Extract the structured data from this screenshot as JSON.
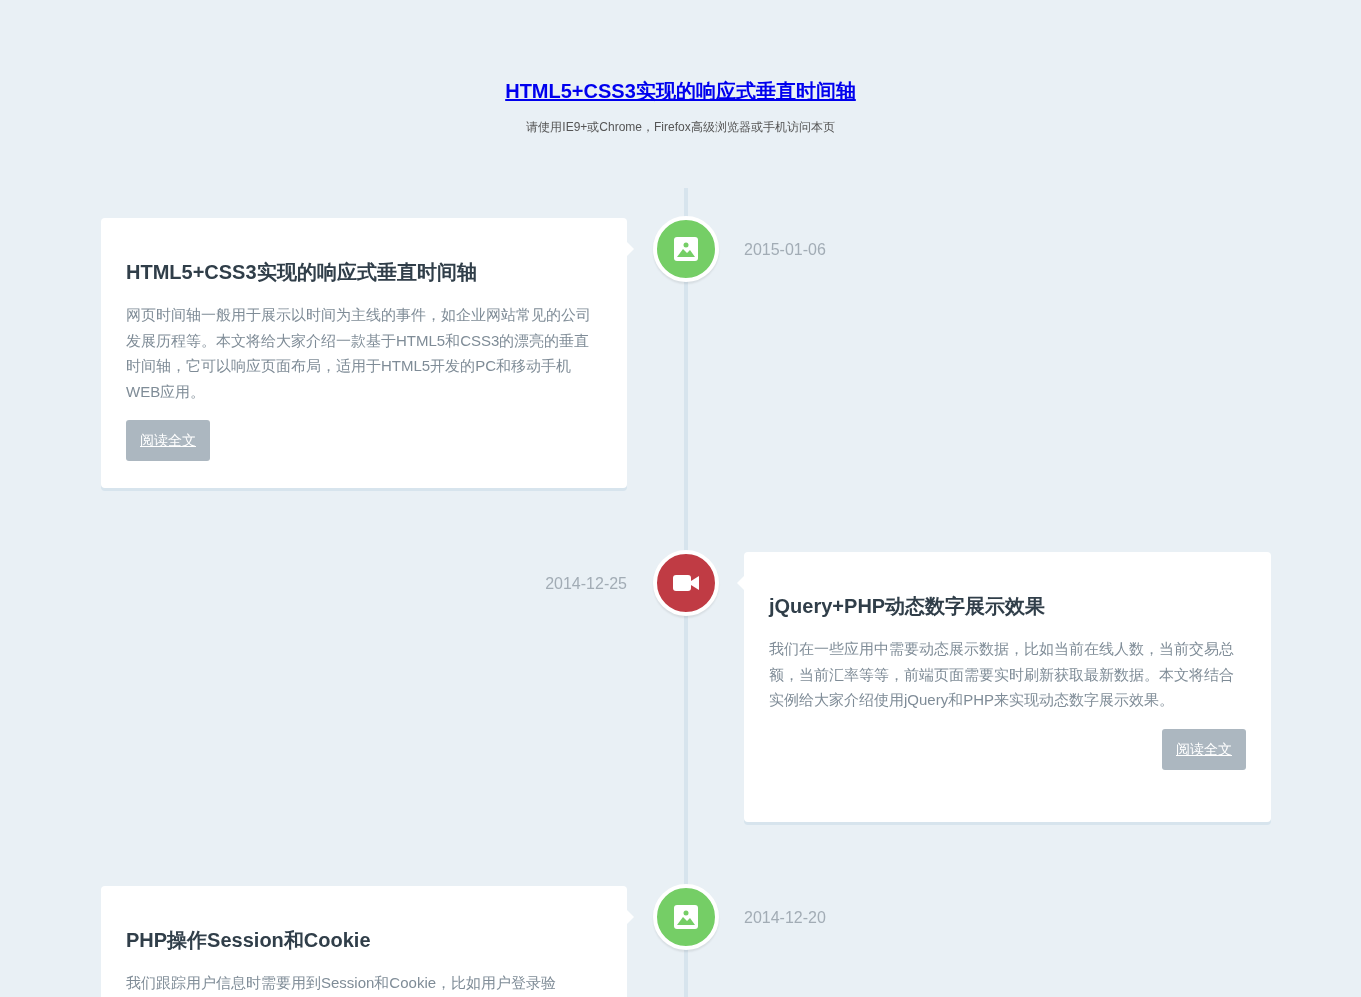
{
  "header": {
    "title": "HTML5+CSS3实现的响应式垂直时间轴",
    "subtitle": "请使用IE9+或Chrome，Firefox高级浏览器或手机访问本页"
  },
  "entries": [
    {
      "kind": "picture",
      "title": "HTML5+CSS3实现的响应式垂直时间轴",
      "text": "网页时间轴一般用于展示以时间为主线的事件，如企业网站常见的公司发展历程等。本文将给大家介绍一款基于HTML5和CSS3的漂亮的垂直时间轴，它可以响应页面布局，适用于HTML5开发的PC和移动手机WEB应用。",
      "button": "阅读全文",
      "date": "2015-01-06"
    },
    {
      "kind": "video",
      "title": "jQuery+PHP动态数字展示效果",
      "text": "我们在一些应用中需要动态展示数据，比如当前在线人数，当前交易总额，当前汇率等等，前端页面需要实时刷新获取最新数据。本文将结合实例给大家介绍使用jQuery和PHP来实现动态数字展示效果。",
      "button": "阅读全文",
      "date": "2014-12-25"
    },
    {
      "kind": "picture",
      "title": "PHP操作Session和Cookie",
      "text": "我们跟踪用户信息时需要用到Session和Cookie，比如用户登录验",
      "date": "2014-12-20"
    }
  ]
}
